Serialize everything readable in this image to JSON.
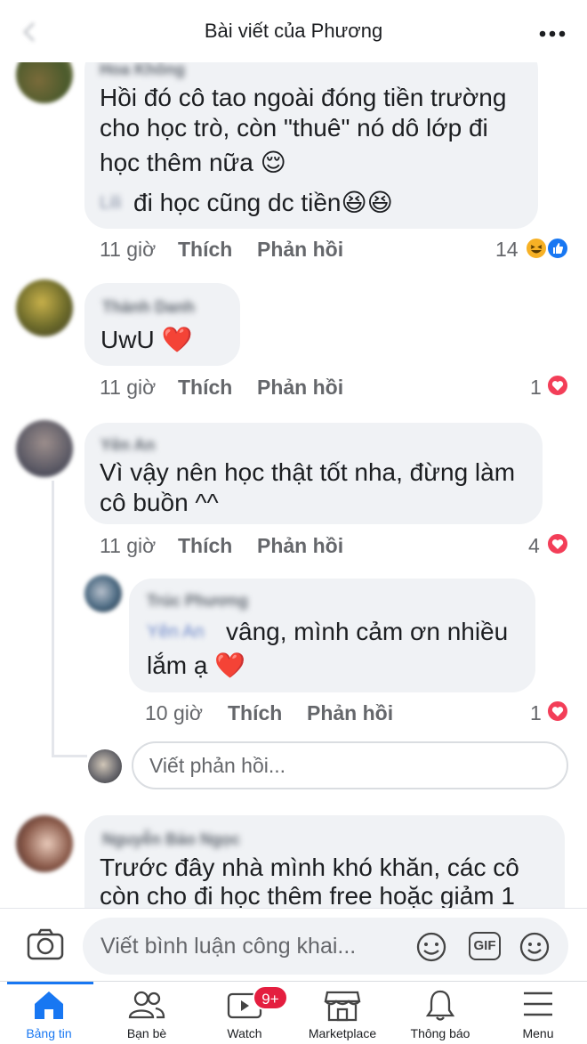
{
  "header": {
    "title": "Bài viết của Phương"
  },
  "colors": {
    "accent": "#1877f2",
    "heart": "#f33e58",
    "like": "#1877f2",
    "badge": "#e41e3f"
  },
  "comments": [
    {
      "name": "Hoa Không",
      "lines": [
        "Hồi đó cô tao ngoài đóng tiền trường",
        "cho học trò, còn \"thuê\" nó dô lớp đi",
        "học thêm nữa 😌"
      ],
      "line2_mention": "Lili",
      "line2_text": " đi học cũng dc tiền😆😆",
      "time": "11 giờ",
      "like": "Thích",
      "reply": "Phản hồi",
      "count": "14",
      "reactions": [
        "haha",
        "like"
      ]
    },
    {
      "name": "Thành Danh",
      "lines": [
        "UwU ❤️"
      ],
      "time": "11 giờ",
      "like": "Thích",
      "reply": "Phản hồi",
      "count": "1",
      "reactions": [
        "heart"
      ]
    },
    {
      "name": "Yên An",
      "lines": [
        "Vì vậy nên học thật tốt nha, đừng làm",
        "cô buồn ^^"
      ],
      "time": "11 giờ",
      "like": "Thích",
      "reply": "Phản hồi",
      "count": "4",
      "reactions": [
        "heart"
      ],
      "reply_item": {
        "name": "Trúc Phương",
        "mention": "Yên An",
        "line1": " vâng, mình cảm ơn nhiều",
        "line2": "lắm ạ ❤️",
        "time": "10 giờ",
        "like": "Thích",
        "reply": "Phản hồi",
        "count": "1",
        "reactions": [
          "heart"
        ]
      }
    },
    {
      "name": "Nguyễn Bảo Ngọc",
      "lines": [
        "Trước đây nhà mình khó khăn, các cô",
        "còn cho đi học thêm free hoặc giảm 1"
      ]
    }
  ],
  "reply_input": {
    "placeholder": "Viết phản hồi..."
  },
  "composer": {
    "placeholder": "Viết bình luận công khai...",
    "gif_label": "GIF"
  },
  "tabs": [
    {
      "label": "Bảng tin",
      "icon": "home-icon",
      "active": true
    },
    {
      "label": "Bạn bè",
      "icon": "friends-icon"
    },
    {
      "label": "Watch",
      "icon": "watch-icon",
      "badge": "9+"
    },
    {
      "label": "Marketplace",
      "icon": "marketplace-icon"
    },
    {
      "label": "Thông báo",
      "icon": "bell-icon"
    },
    {
      "label": "Menu",
      "icon": "menu-icon"
    }
  ]
}
